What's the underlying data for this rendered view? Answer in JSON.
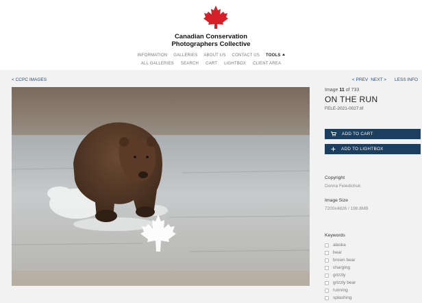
{
  "brand": {
    "line1": "Canadian Conservation",
    "line2": "Photographers Collective"
  },
  "nav": {
    "row1": [
      "INFORMATION",
      "GALLERIES",
      "ABOUT US",
      "CONTACT US"
    ],
    "tools": "TOOLS",
    "row2": [
      "ALL GALLERIES",
      "SEARCH",
      "CART",
      "LIGHTBOX",
      "CLIENT AREA"
    ]
  },
  "back_link": "< CCPC IMAGES",
  "pager": {
    "prev": "< PREV",
    "next": "NEXT >",
    "less_info": "LESS INFO"
  },
  "image": {
    "counter_prefix": "Image",
    "index": "11",
    "of_text": "of 733",
    "title": "ON THE RUN",
    "filename": "FELE-2021-0027.tif"
  },
  "buttons": {
    "cart": "ADD TO CART",
    "lightbox": "ADD TO LIGHTBOX"
  },
  "meta": {
    "copyright_label": "Copyright",
    "copyright_value": "Donna Feledichuk",
    "size_label": "Image Size",
    "size_value": "7200x4826 / 198.8MB",
    "keywords_label": "Keywords"
  },
  "keywords": [
    "alaska",
    "bear",
    "brown bear",
    "charging",
    "grizzly",
    "grizzly bear",
    "running",
    "splashing"
  ],
  "colors": {
    "accent_blue": "#1c3f5f",
    "link_blue": "#1f4f88",
    "maple_red": "#d62027"
  }
}
